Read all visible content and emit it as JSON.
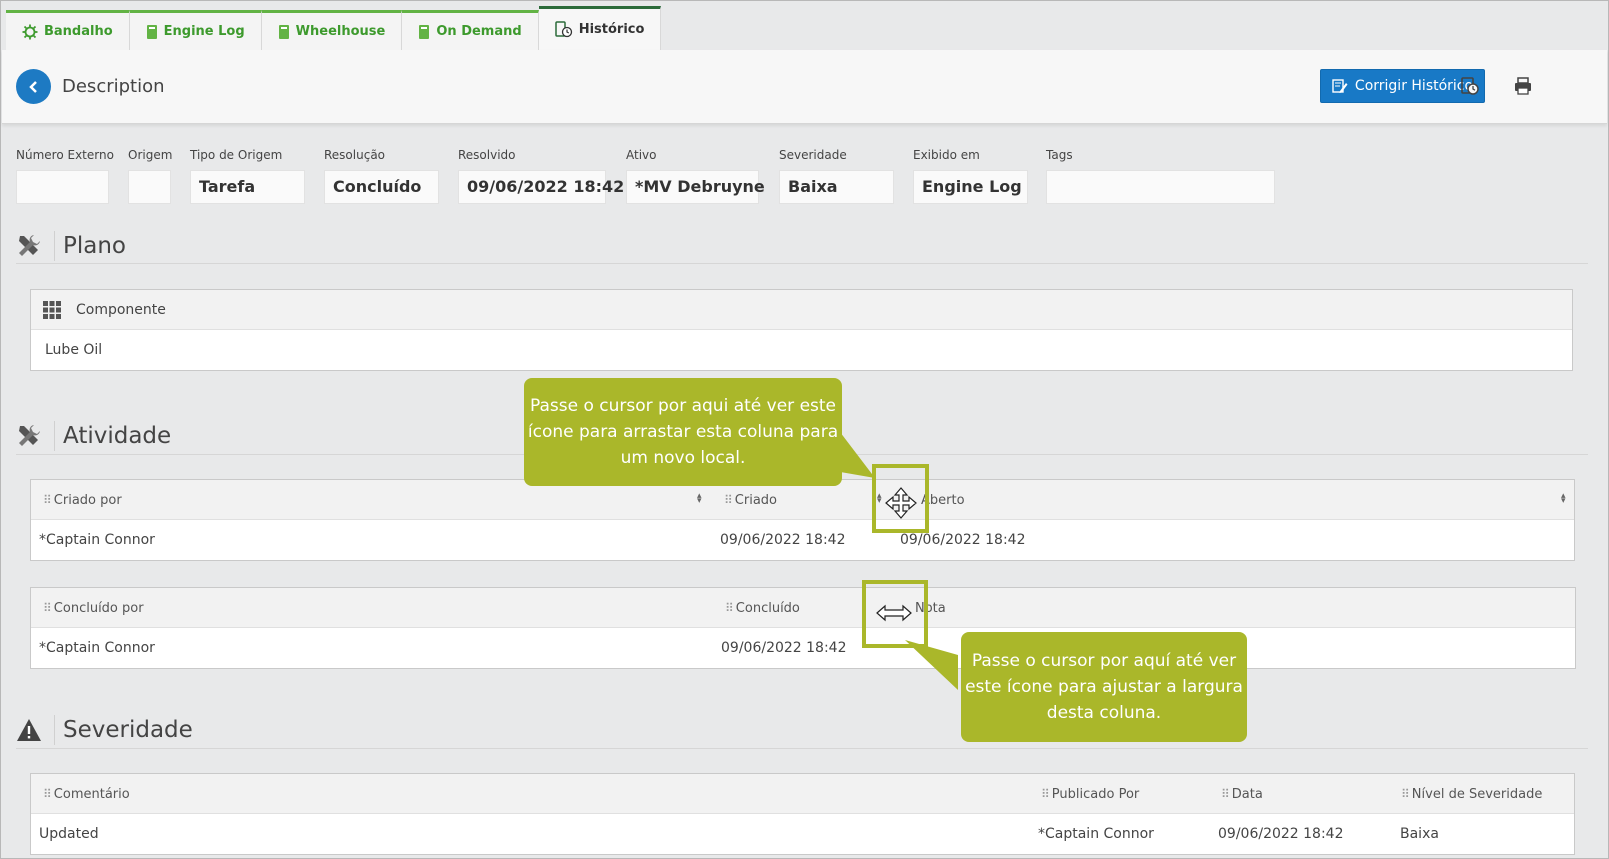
{
  "tabs": [
    {
      "label": "Bandalho",
      "icon": "gear-icon"
    },
    {
      "label": "Engine Log",
      "icon": "book-icon"
    },
    {
      "label": "Wheelhouse",
      "icon": "book-icon"
    },
    {
      "label": "On Demand",
      "icon": "book-icon"
    },
    {
      "label": "Histórico",
      "icon": "history-book-icon"
    }
  ],
  "header": {
    "title": "Description",
    "corrigir_label": "Corrigir Histórico"
  },
  "fields": [
    {
      "label": "Número Externo",
      "value": ""
    },
    {
      "label": "Origem",
      "value": ""
    },
    {
      "label": "Tipo de Origem",
      "value": "Tarefa"
    },
    {
      "label": "Resolução",
      "value": "Concluído"
    },
    {
      "label": "Resolvido",
      "value": "09/06/2022 18:42"
    },
    {
      "label": "Ativo",
      "value": "*MV Debruyne"
    },
    {
      "label": "Severidade",
      "value": "Baixa"
    },
    {
      "label": "Exibido em",
      "value": "Engine Log"
    },
    {
      "label": "Tags",
      "value": ""
    }
  ],
  "plano": {
    "title": "Plano",
    "header": "Componente",
    "row": "Lube Oil"
  },
  "atividade": {
    "title": "Atividade",
    "table1": {
      "headers": [
        "Criado por",
        "Criado",
        "Aberto"
      ],
      "row": [
        "*Captain Connor",
        "09/06/2022 18:42",
        "09/06/2022 18:42"
      ]
    },
    "table2": {
      "headers": [
        "Concluído por",
        "Concluído",
        "Nota"
      ],
      "row": [
        "*Captain Connor",
        "09/06/2022 18:42",
        ""
      ]
    }
  },
  "severidade": {
    "title": "Severidade",
    "headers": [
      "Comentário",
      "Publicado Por",
      "Data",
      "Nível de Severidade"
    ],
    "row": [
      "Updated",
      "*Captain Connor",
      "09/06/2022 18:42",
      "Baixa"
    ]
  },
  "callouts": {
    "drag": "Passe o cursor por aqui até ver este ícone para arrastar esta coluna para um novo local.",
    "resize": "Passe o cursor por aquí até ver este ícone para ajustar a largura desta coluna."
  },
  "colors": {
    "tab_green": "#62b344",
    "accent_blue": "#1879c6",
    "callout_green": "#aab72a"
  }
}
